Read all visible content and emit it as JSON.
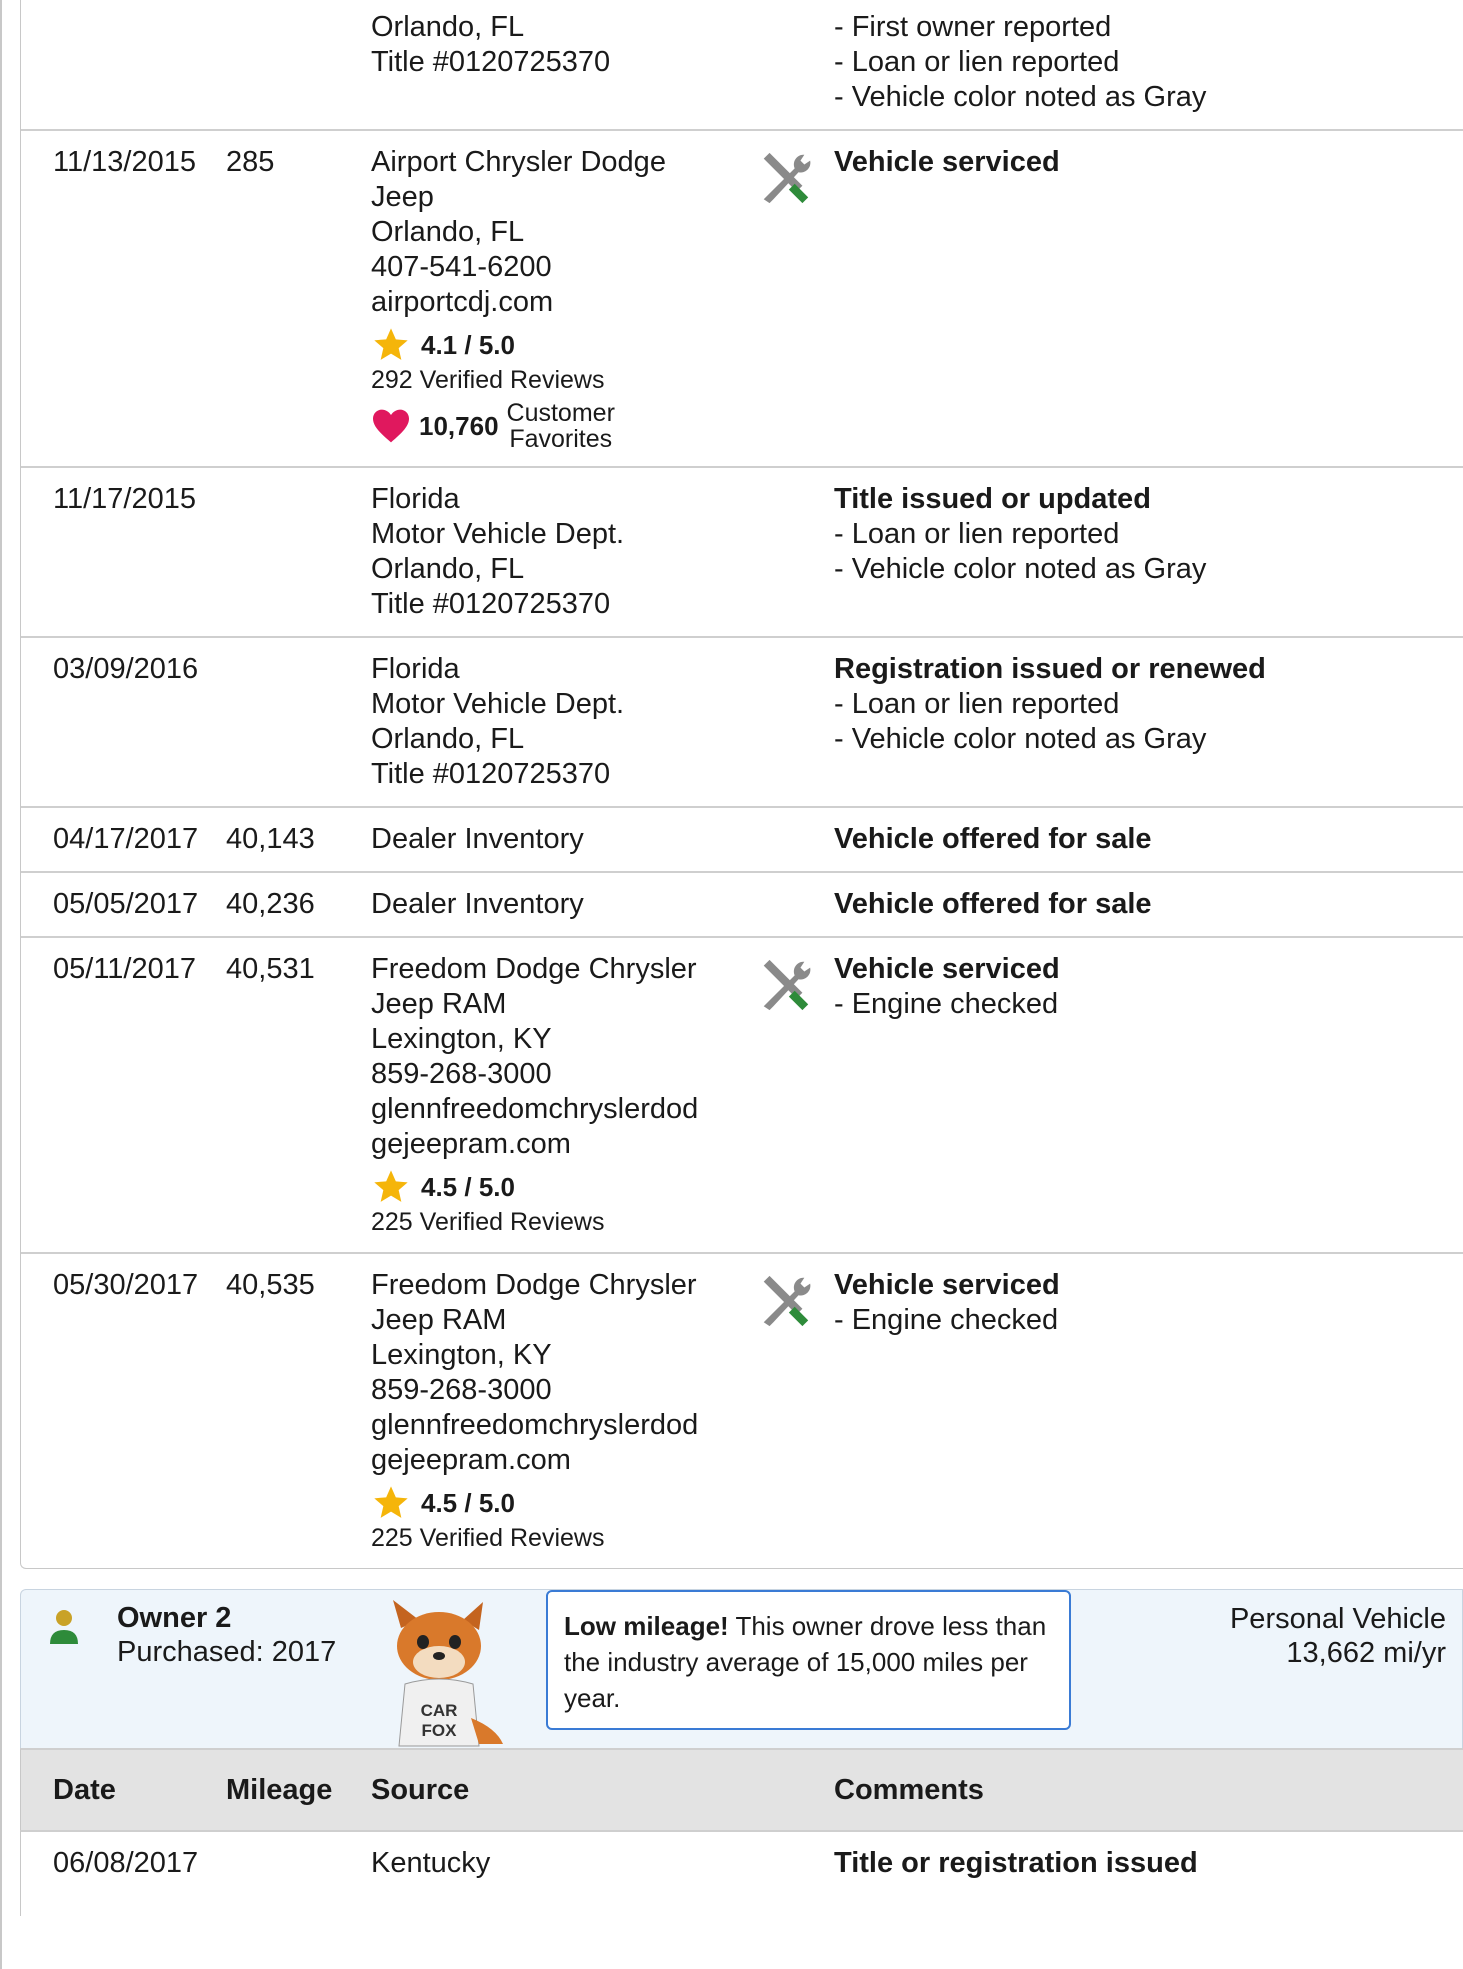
{
  "records": [
    {
      "date": "",
      "mileage": "",
      "source_lines": [
        "Orlando, FL",
        "Title #0120725370"
      ],
      "has_service_icon": false,
      "comment_title": "",
      "comment_items": [
        "- First owner reported",
        "- Loan or lien reported",
        "- Vehicle color noted as Gray"
      ]
    },
    {
      "date": "11/13/2015",
      "mileage": "285",
      "source_lines": [
        "Airport Chrysler Dodge",
        "Jeep",
        "Orlando, FL",
        "407-541-6200",
        "airportcdj.com"
      ],
      "rating": "4.1 / 5.0",
      "reviews": "292 Verified Reviews",
      "favorites_count": "10,760",
      "favorites_label_1": "Customer",
      "favorites_label_2": "Favorites",
      "has_service_icon": true,
      "comment_title": "Vehicle serviced",
      "comment_items": []
    },
    {
      "date": "11/17/2015",
      "mileage": "",
      "source_lines": [
        "Florida",
        "Motor Vehicle Dept.",
        "Orlando, FL",
        "Title #0120725370"
      ],
      "has_service_icon": false,
      "comment_title": "Title issued or updated",
      "comment_items": [
        "- Loan or lien reported",
        "- Vehicle color noted as Gray"
      ]
    },
    {
      "date": "03/09/2016",
      "mileage": "",
      "source_lines": [
        "Florida",
        "Motor Vehicle Dept.",
        "Orlando, FL",
        "Title #0120725370"
      ],
      "has_service_icon": false,
      "comment_title": "Registration issued or renewed",
      "comment_items": [
        "- Loan or lien reported",
        "- Vehicle color noted as Gray"
      ]
    },
    {
      "date": "04/17/2017",
      "mileage": "40,143",
      "source_lines": [
        "Dealer Inventory"
      ],
      "has_service_icon": false,
      "comment_title": "Vehicle offered for sale",
      "comment_items": []
    },
    {
      "date": "05/05/2017",
      "mileage": "40,236",
      "source_lines": [
        "Dealer Inventory"
      ],
      "has_service_icon": false,
      "comment_title": "Vehicle offered for sale",
      "comment_items": []
    },
    {
      "date": "05/11/2017",
      "mileage": "40,531",
      "source_lines": [
        "Freedom Dodge Chrysler",
        "Jeep RAM",
        "Lexington, KY",
        "859-268-3000",
        "glennfreedomchryslerdod",
        "gejeepram.com"
      ],
      "rating": "4.5 / 5.0",
      "reviews": "225 Verified Reviews",
      "has_service_icon": true,
      "comment_title": "Vehicle serviced",
      "comment_items": [
        "- Engine checked"
      ]
    },
    {
      "date": "05/30/2017",
      "mileage": "40,535",
      "source_lines": [
        "Freedom Dodge Chrysler",
        "Jeep RAM",
        "Lexington, KY",
        "859-268-3000",
        "glennfreedomchryslerdod",
        "gejeepram.com"
      ],
      "rating": "4.5 / 5.0",
      "reviews": "225 Verified Reviews",
      "has_service_icon": true,
      "comment_title": "Vehicle serviced",
      "comment_items": [
        "- Engine checked"
      ]
    }
  ],
  "owner2": {
    "name": "Owner 2",
    "purchased": "Purchased: 2017",
    "callout_bold": "Low mileage!",
    "callout_text": " This owner drove less than the industry average of 15,000 miles per year.",
    "vehicle_type": "Personal Vehicle",
    "mileage_rate": "13,662 mi/yr",
    "fox_shirt_text": "CAR FOX"
  },
  "columns": {
    "date": "Date",
    "mileage": "Mileage",
    "source": "Source",
    "comments": "Comments"
  },
  "owner2_first_record": {
    "date": "06/08/2017",
    "mileage": "",
    "source": "Kentucky",
    "comment_title": "Title or registration issued"
  },
  "colors": {
    "star": "#f5b50a",
    "heart": "#e0185e",
    "wrench_gray": "#8a8a8a",
    "wrench_green": "#2e8b3a",
    "callout_border": "#3a7bd5",
    "owner_bg": "#eef5fb",
    "header_bg": "#e3e3e3"
  }
}
